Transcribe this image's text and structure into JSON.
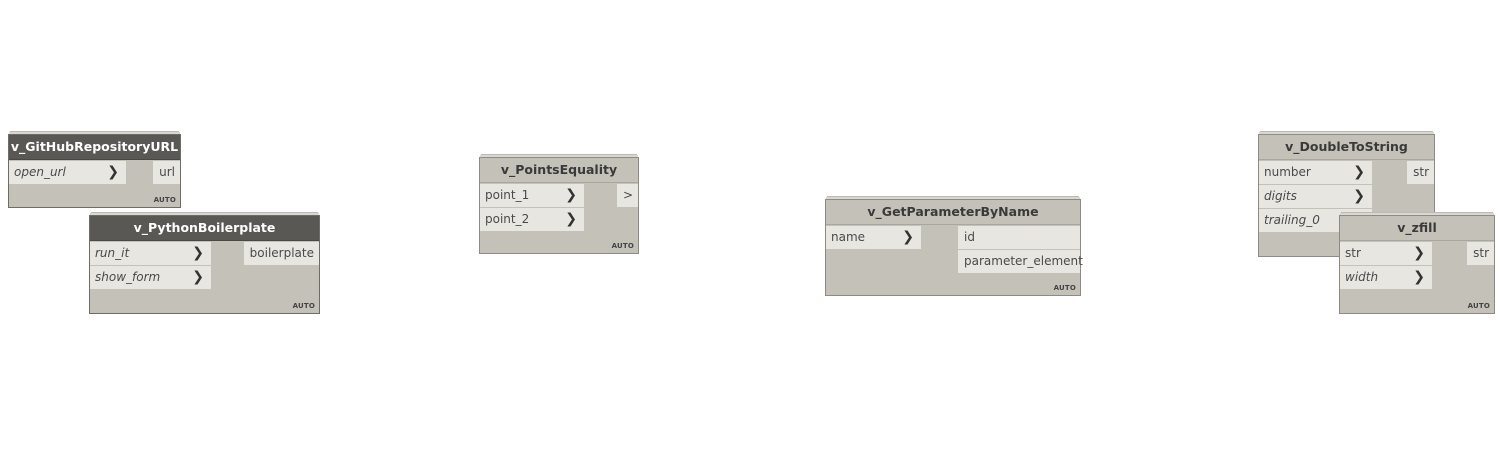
{
  "colors": {
    "canvas": "#ffffff",
    "node_body": "#c4c1b9",
    "port_bg": "#e8e6e1",
    "dark_header": "#5a5855"
  },
  "nodes": {
    "github": {
      "title": "v_GitHubRepositoryURL",
      "inputs": [
        "open_url"
      ],
      "outputs": [
        "url"
      ],
      "lacing": "AUTO",
      "arrow": "❯"
    },
    "python": {
      "title": "v_PythonBoilerplate",
      "inputs": [
        "run_it",
        "show_form"
      ],
      "outputs": [
        "boilerplate"
      ],
      "lacing": "AUTO",
      "arrow": "❯"
    },
    "points": {
      "title": "v_PointsEquality",
      "inputs": [
        "point_1",
        "point_2"
      ],
      "outputs": [
        ">"
      ],
      "lacing": "AUTO",
      "arrow": "❯"
    },
    "param": {
      "title": "v_GetParameterByName",
      "inputs": [
        "name"
      ],
      "outputs": [
        "id",
        "parameter_element"
      ],
      "lacing": "AUTO",
      "arrow": "❯"
    },
    "double": {
      "title": "v_DoubleToString",
      "inputs": [
        "number",
        "digits",
        "trailing_0"
      ],
      "outputs": [
        "str"
      ],
      "lacing": "AUTO",
      "arrow": "❯"
    },
    "zfill": {
      "title": "v_zfill",
      "inputs": [
        "str",
        "width"
      ],
      "outputs": [
        "str"
      ],
      "lacing": "AUTO",
      "arrow": "❯"
    }
  }
}
